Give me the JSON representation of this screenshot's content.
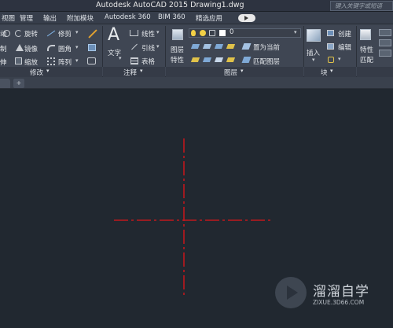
{
  "titlebar": {
    "title": "Autodesk AutoCAD 2015    Drawing1.dwg",
    "search_placeholder": "键入关键字或短语"
  },
  "menubar": {
    "items": [
      "视图",
      "管理",
      "输出",
      "附加模块",
      "Autodesk 360",
      "BIM 360",
      "精选应用"
    ]
  },
  "ribbon": {
    "modify": {
      "row1": [
        "动",
        "旋转",
        "修剪"
      ],
      "row2": [
        "制",
        "镜像",
        "圆角"
      ],
      "row3": [
        "伸",
        "缩放",
        "阵列"
      ],
      "panel_title": "修改"
    },
    "annotation": {
      "text_label": "文字",
      "linear_label": "线性",
      "leader_label": "引线",
      "table_label": "表格",
      "panel_title": "注释"
    },
    "layers": {
      "layer_props_label": "图层\n特性",
      "layer_props_line1": "图层",
      "layer_props_line2": "特性",
      "current_layer": "0",
      "set_current_label": "置为当前",
      "match_layer_label": "匹配图层",
      "panel_title": "图层"
    },
    "block": {
      "insert_label": "插入",
      "create_label": "创建",
      "edit_label": "编辑",
      "panel_title": "块"
    },
    "properties": {
      "match_line1": "特性",
      "match_line2": "匹配"
    }
  },
  "watermark": {
    "title": "溜溜自学",
    "url": "ZIXUE.3D66.COM"
  },
  "colors": {
    "canvas_bg": "#212830",
    "crosshair": "#c0181c",
    "ribbon_bg": "#3f4653"
  }
}
